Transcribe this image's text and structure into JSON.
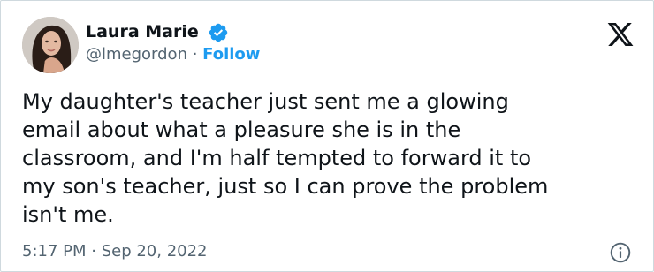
{
  "user": {
    "name": "Laura Marie",
    "handle": "@lmegordon",
    "separator": " · ",
    "follow_label": "Follow"
  },
  "tweet": {
    "text": "My daughter's teacher just sent me a glowing\nemail about what a pleasure she is in the\nclassroom, and I'm half tempted to forward it to\nmy son's teacher, just so I can prove the problem\nisn't me.",
    "time": "5:17 PM",
    "separator": " · ",
    "date": "Sep 20, 2022"
  },
  "colors": {
    "accent": "#1d9bf0",
    "text_primary": "#0f1419",
    "text_secondary": "#536471"
  },
  "icons": {
    "verified": "verified-badge-icon",
    "platform_logo": "x-logo-icon",
    "info": "info-icon"
  }
}
